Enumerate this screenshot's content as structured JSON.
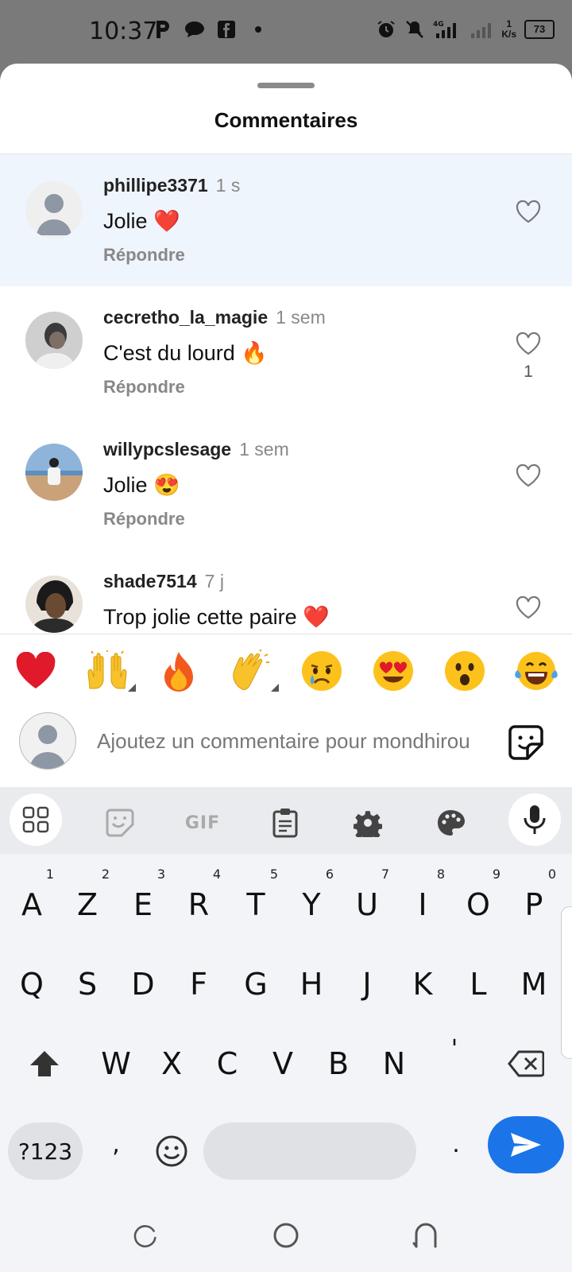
{
  "status_bar": {
    "time": "10:37",
    "network": "4G",
    "speed_value": "1",
    "speed_unit": "K/s",
    "battery": "73"
  },
  "sheet": {
    "title": "Commentaires"
  },
  "comments": [
    {
      "username": "phillipe3371",
      "time": "1 s",
      "text": "Jolie ❤️",
      "reply": "Répondre",
      "likes": ""
    },
    {
      "username": "cecretho_la_magie",
      "time": "1 sem",
      "text": "C'est du lourd 🔥",
      "reply": "Répondre",
      "likes": "1"
    },
    {
      "username": "willypcslesage",
      "time": "1 sem",
      "text": "Jolie 😍",
      "reply": "Répondre",
      "likes": ""
    },
    {
      "username": "shade7514",
      "time": "7 j",
      "text": "Trop jolie cette paire ❤️",
      "reply": "",
      "likes": ""
    }
  ],
  "reactions": [
    "❤️",
    "🙌",
    "🔥",
    "👏",
    "😢",
    "😍",
    "😮",
    "😂"
  ],
  "composer": {
    "placeholder": "Ajoutez un commentaire pour mondhirou"
  },
  "keyboard": {
    "toolbar_gif": "GIF",
    "row1": [
      [
        "A",
        "1"
      ],
      [
        "Z",
        "2"
      ],
      [
        "E",
        "3"
      ],
      [
        "R",
        "4"
      ],
      [
        "T",
        "5"
      ],
      [
        "Y",
        "6"
      ],
      [
        "U",
        "7"
      ],
      [
        "I",
        "8"
      ],
      [
        "O",
        "9"
      ],
      [
        "P",
        "0"
      ]
    ],
    "row2": [
      "Q",
      "S",
      "D",
      "F",
      "G",
      "H",
      "J",
      "K",
      "L",
      "M"
    ],
    "row3": [
      "W",
      "X",
      "C",
      "V",
      "B",
      "N",
      "'"
    ],
    "symbols_key": "?123",
    "comma": ",",
    "period": "."
  },
  "colors": {
    "accent": "#1b74e8",
    "highlight_row": "#eff5fc",
    "heart_red": "#e0192b"
  }
}
